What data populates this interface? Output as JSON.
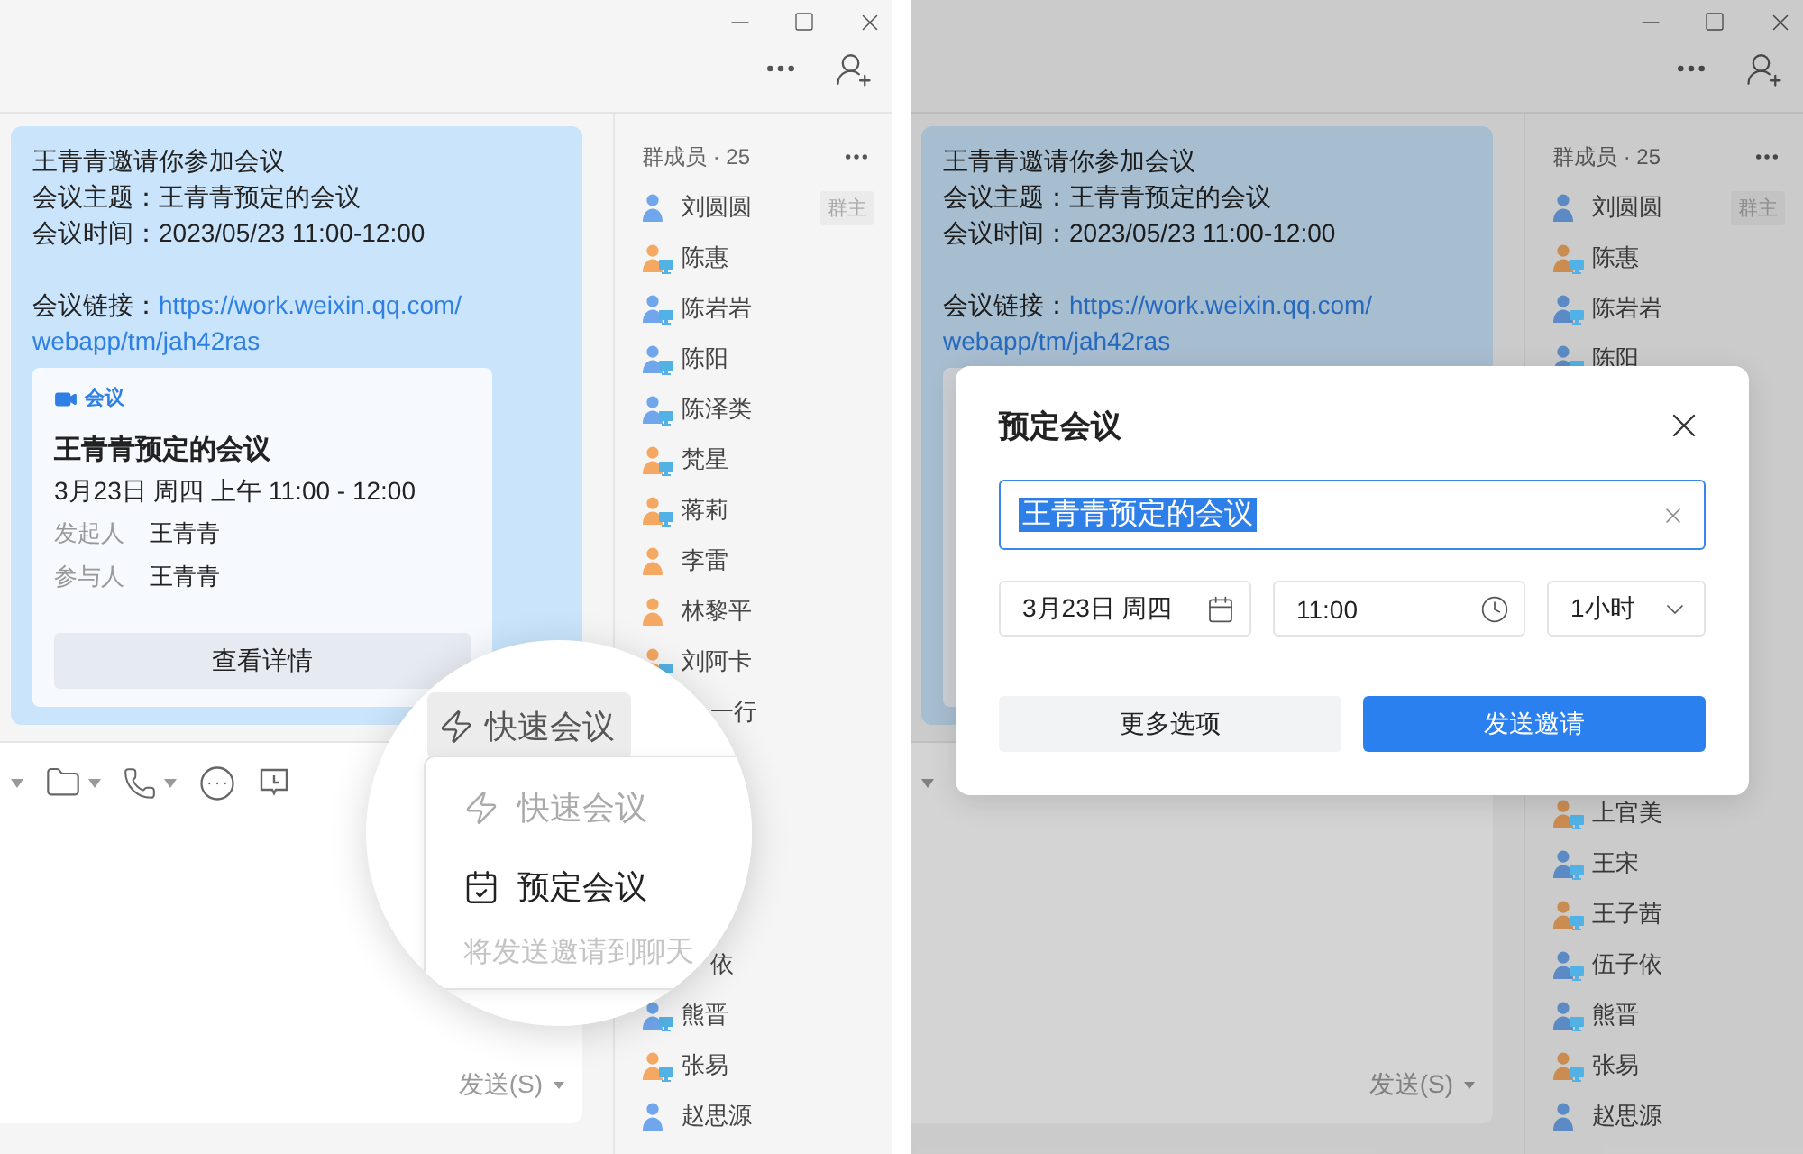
{
  "panels": [
    {
      "chat": {
        "message": {
          "lines": [
            "王青青邀请你参加会议",
            "会议主题：王青青预定的会议",
            "会议时间：2023/05/23 11:00-12:00"
          ],
          "link_label": "会议链接：",
          "link": [
            "https://work.weixin.qq.com/",
            "webapp/tm/jah42ras"
          ],
          "card": {
            "tag": "会议",
            "title": "王青青预定的会议",
            "time": "3月23日 周四 上午 11:00 - 12:00",
            "fields": [
              {
                "label": "发起人",
                "value": "王青青"
              },
              {
                "label": "参与人",
                "value": "王青青"
              }
            ],
            "button": "查看详情"
          }
        },
        "send": "发送(S)"
      },
      "members": {
        "title": "群成员 · 25",
        "top": [
          {
            "kind": "member",
            "name": "刘圆圆",
            "color": "#6fa6ec",
            "on_pc": false,
            "badge": "群主"
          },
          {
            "kind": "member",
            "name": "陈惠",
            "color": "#f4a862",
            "on_pc": true
          },
          {
            "kind": "member",
            "name": "陈岩岩",
            "color": "#6fa6ec",
            "on_pc": true
          },
          {
            "kind": "member",
            "name": "陈阳",
            "color": "#6fa6ec",
            "on_pc": true
          },
          {
            "kind": "member",
            "name": "陈泽类",
            "color": "#6fa6ec",
            "on_pc": true
          },
          {
            "kind": "member",
            "name": "梵星",
            "color": "#f4a862",
            "on_pc": true
          },
          {
            "kind": "member",
            "name": "蒋莉",
            "color": "#f4a862",
            "on_pc": true
          },
          {
            "kind": "member",
            "name": "李雷",
            "color": "#f4a862",
            "on_pc": false
          },
          {
            "kind": "member",
            "name": "林黎平",
            "color": "#f4a862",
            "on_pc": false
          },
          {
            "kind": "member",
            "name": "刘阿卡",
            "color": "#f4a862",
            "on_pc": true
          },
          {
            "kind": "partial",
            "name": "一行"
          }
        ],
        "bottom": [
          {
            "kind": "partial",
            "name": "依"
          },
          {
            "kind": "member",
            "name": "熊晋",
            "color": "#6fa6ec",
            "on_pc": true
          },
          {
            "kind": "member",
            "name": "张易",
            "color": "#f4a862",
            "on_pc": true
          },
          {
            "kind": "member",
            "name": "赵思源",
            "color": "#6fa6ec",
            "on_pc": false
          }
        ]
      },
      "magnifier": {
        "button": "快速会议",
        "menu": [
          {
            "kind": "quick",
            "label": "快速会议",
            "disabled": true
          },
          {
            "kind": "schedule",
            "label": "预定会议",
            "disabled": false
          }
        ],
        "hint": "将发送邀请到聊天"
      }
    },
    {
      "chat": {
        "message": {
          "lines": [
            "王青青邀请你参加会议",
            "会议主题：王青青预定的会议",
            "会议时间：2023/05/23 11:00-12:00"
          ],
          "link_label": "会议链接：",
          "link": [
            "https://work.weixin.qq.com/",
            "webapp/tm/jah42ras"
          ]
        },
        "send": "发送(S)"
      },
      "members": {
        "title": "群成员 · 25",
        "top": [
          {
            "kind": "member",
            "name": "刘圆圆",
            "color": "#5c8ac4",
            "on_pc": false,
            "badge": "群主"
          },
          {
            "kind": "member",
            "name": "陈惠",
            "color": "#cb8c51",
            "on_pc": true
          },
          {
            "kind": "member",
            "name": "陈岩岩",
            "color": "#5c8ac4",
            "on_pc": true
          },
          {
            "kind": "member",
            "name": "陈阳",
            "color": "#5c8ac4",
            "on_pc": true
          }
        ],
        "bottom": [
          {
            "kind": "member",
            "name": "上官美",
            "color": "#cb8c51",
            "on_pc": true
          },
          {
            "kind": "member",
            "name": "王宋",
            "color": "#5c8ac4",
            "on_pc": true
          },
          {
            "kind": "member",
            "name": "王子茜",
            "color": "#cb8c51",
            "on_pc": true
          },
          {
            "kind": "member",
            "name": "伍子依",
            "color": "#5c8ac4",
            "on_pc": true
          },
          {
            "kind": "member",
            "name": "熊晋",
            "color": "#5c8ac4",
            "on_pc": true
          },
          {
            "kind": "member",
            "name": "张易",
            "color": "#cb8c51",
            "on_pc": true
          },
          {
            "kind": "member",
            "name": "赵思源",
            "color": "#5c8ac4",
            "on_pc": false
          }
        ]
      },
      "dialog": {
        "title": "预定会议",
        "topic": {
          "value": "王青青预定的会议",
          "text_selected": true
        },
        "date": "3月23日 周四",
        "time": "11:00",
        "duration": "1小时",
        "buttons": [
          {
            "label": "更多选项",
            "primary": false
          },
          {
            "label": "发送邀请",
            "primary": true
          }
        ]
      }
    }
  ]
}
